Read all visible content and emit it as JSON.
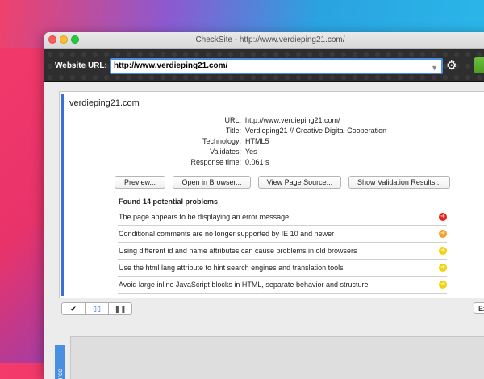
{
  "window": {
    "title": "CheckSite - http://www.verdieping21.com/"
  },
  "toolbar": {
    "url_label": "Website URL:",
    "url_value": "http://www.verdieping21.com/"
  },
  "site": {
    "name": "verdieping21.com"
  },
  "info": [
    {
      "label": "URL:",
      "value": "http://www.verdieping21.com/"
    },
    {
      "label": "Title:",
      "value": "Verdieping21 // Creative Digital Cooperation"
    },
    {
      "label": "Technology:",
      "value": "HTML5"
    },
    {
      "label": "Validates:",
      "value": "Yes"
    },
    {
      "label": "Response time:",
      "value": "0.061 s"
    }
  ],
  "buttons": {
    "preview": "Preview...",
    "open_browser": "Open in Browser...",
    "view_source": "View Page Source...",
    "show_validation": "Show Validation Results..."
  },
  "problems": {
    "title": "Found 14 potential problems",
    "items": [
      {
        "text": "The page appears to be displaying an error message",
        "severity": "red",
        "color": "#e8231a"
      },
      {
        "text": "Conditional comments are no longer supported by IE 10 and newer",
        "severity": "orange",
        "color": "#f2a02a"
      },
      {
        "text": "Using different id and name attributes can cause problems in old browsers",
        "severity": "yellow",
        "color": "#f1d20b"
      },
      {
        "text": "Use the html lang attribute to hint search engines and translation tools",
        "severity": "yellow",
        "color": "#f1d20b"
      },
      {
        "text": "Avoid large inline JavaScript blocks in HTML, separate behavior and structure",
        "severity": "yellow",
        "color": "#f1d20b"
      }
    ]
  },
  "footer": {
    "export_label": "Ex"
  },
  "side_tab": {
    "label": "urce"
  },
  "icons": {
    "check": "check-icon",
    "columns": "columns-icon",
    "split": "split-icon",
    "gear": "gear-icon",
    "arrow": "arrow-right-icon"
  },
  "colors": {
    "accent": "#3b6fd8",
    "url_border": "#4a90e2",
    "go_button": "#5aad2d"
  }
}
